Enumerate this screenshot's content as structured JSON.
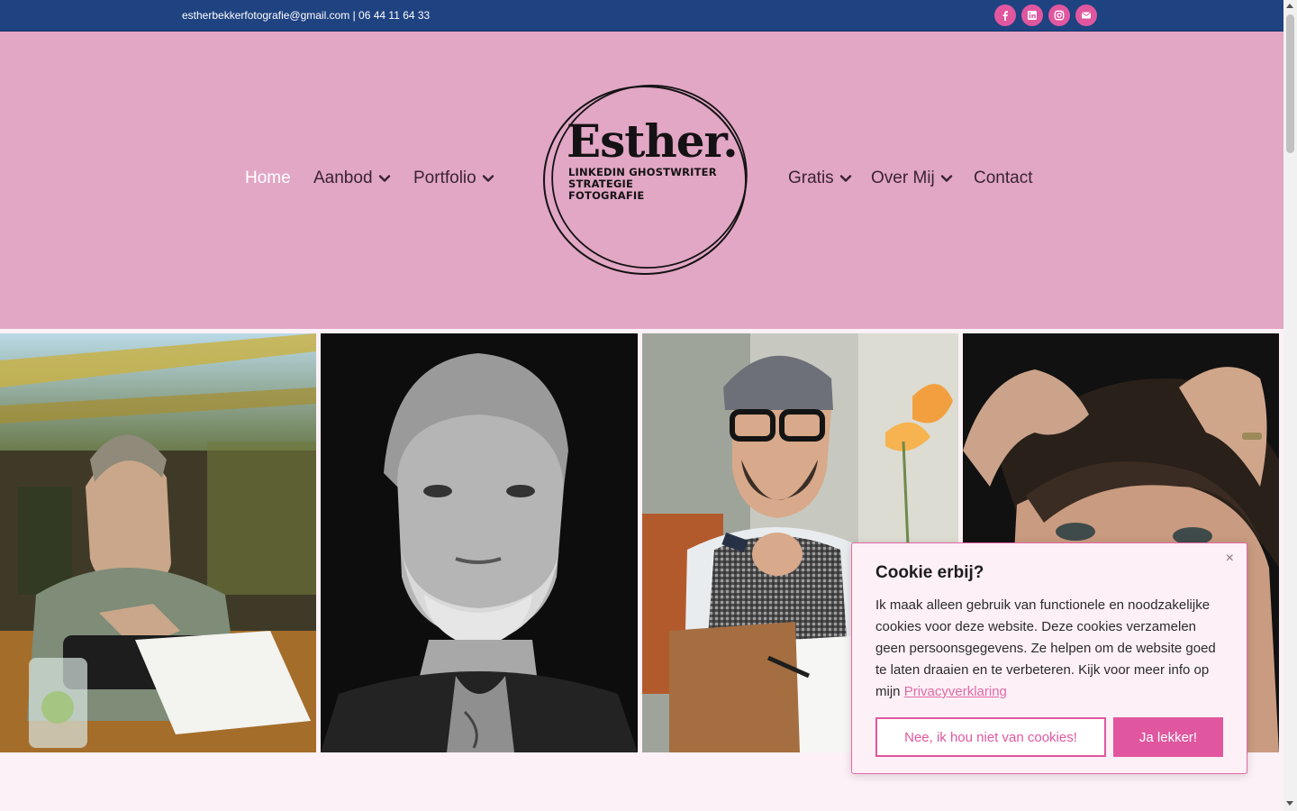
{
  "topbar": {
    "contact": "estherbekkerfotografie@gmail.com | 06 44 11 64 33",
    "socials": [
      {
        "icon": "facebook-icon"
      },
      {
        "icon": "linkedin-icon"
      },
      {
        "icon": "instagram-icon"
      },
      {
        "icon": "envelope-icon"
      }
    ]
  },
  "nav": {
    "left": [
      {
        "label": "Home",
        "active": true,
        "dropdown": false
      },
      {
        "label": "Aanbod",
        "dropdown": true
      },
      {
        "label": "Portfolio",
        "dropdown": true
      }
    ],
    "right": [
      {
        "label": "Gratis",
        "dropdown": true
      },
      {
        "label": "Over Mij",
        "dropdown": true
      },
      {
        "label": "Contact",
        "dropdown": false
      }
    ]
  },
  "logo": {
    "name": "Esther.",
    "tagline": [
      "LINKEDIN GHOSTWRITER",
      "STRATEGIE",
      "FOTOGRAFIE"
    ]
  },
  "gallery": [
    {
      "subject": "man-at-typewriter"
    },
    {
      "subject": "bw-portrait-grey-beard"
    },
    {
      "subject": "man-with-flat-cap-and-glasses"
    },
    {
      "subject": "man-hands-in-hair"
    }
  ],
  "cookie": {
    "title": "Cookie erbij?",
    "text": "Ik maak alleen gebruik van functionele en noodzakelijke cookies voor deze website. Deze cookies verzamelen geen persoonsgegevens. Ze helpen om de website goed te laten draaien en te verbeteren. Kijk voor meer info op mijn",
    "link": "Privacyverklaring",
    "decline": "Nee, ik hou niet van cookies!",
    "accept": "Ja lekker!",
    "close": "×"
  },
  "colors": {
    "topbar": "#1f4281",
    "header": "#e2a7c5",
    "accent": "#e0579f",
    "background": "#fcf1f6"
  }
}
